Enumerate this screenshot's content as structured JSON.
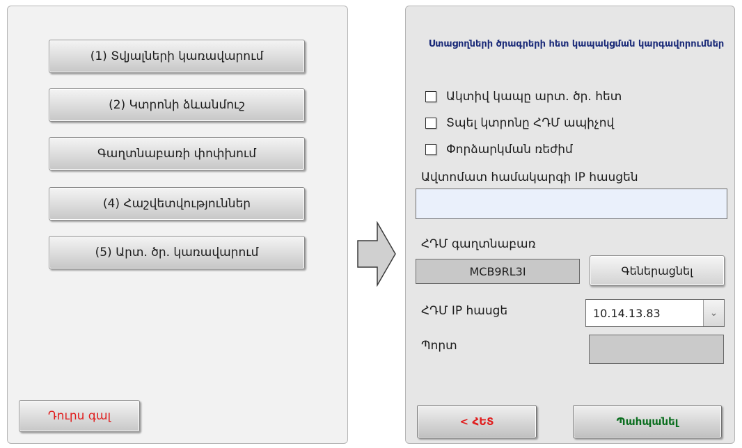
{
  "left_menu": {
    "buttons": [
      {
        "label": "(1) Տվյալների կառավարում"
      },
      {
        "label": "(2) Կտրոնի ձևանմուշ"
      },
      {
        "label": "Գաղտնաբառի փոփխում"
      },
      {
        "label": "(4) Հաշվետվություններ"
      },
      {
        "label": "(5) Արտ. ծր. կառավարում"
      }
    ],
    "exit_label": "Դուրս գալ",
    "exit_color": "#e01e1e"
  },
  "arrow_icon": "right-arrow-icon",
  "settings": {
    "title": "Ստացողների ծրագրերի հետ կապակցման կարգավորումներ",
    "checkboxes": [
      {
        "label": "Ակտիվ կապը արտ. ծր. հետ",
        "checked": false
      },
      {
        "label": "Տպել կտրոնը ՀԴՄ ապիչով",
        "checked": false
      },
      {
        "label": "Փորձարկման ռեժիմ",
        "checked": false
      }
    ],
    "ip_label": "Ավտոմատ համակարգի IP հասցեն",
    "ip_value": "",
    "password_label": "ՀԴՄ գաղտնաբառ",
    "password_value": "MCB9RL3I",
    "generate_label": "Գեներացնել",
    "hdm_ip_label": "ՀԴՄ IP հասցե",
    "hdm_ip_value": "10.14.13.83",
    "port_label": "Պորտ",
    "port_value": "",
    "back_label": "< ՀԵՏ",
    "continue_label": "Պահպանել",
    "title_color": "#1a2a78",
    "back_color": "#e01e1e",
    "continue_color": "#0b6e1f"
  }
}
